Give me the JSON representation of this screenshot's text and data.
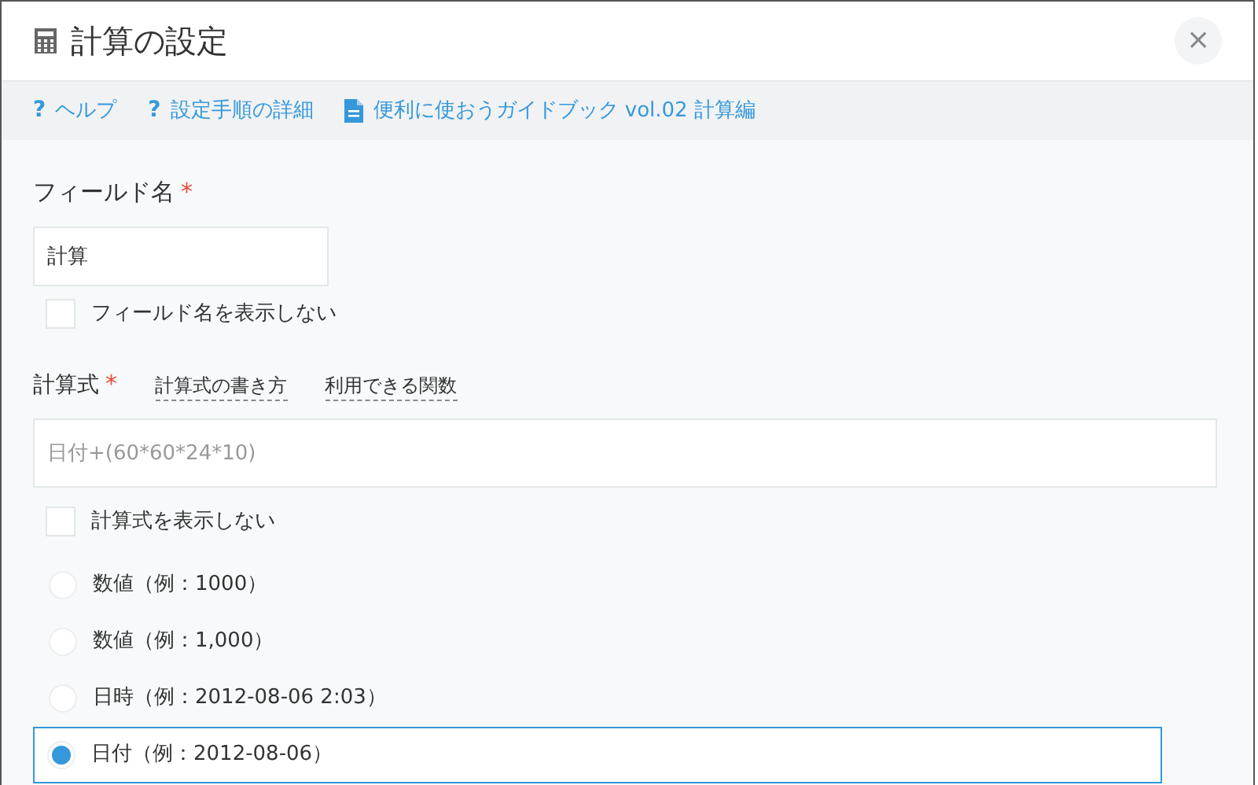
{
  "dialog": {
    "title": "計算の設定",
    "close": "×"
  },
  "links": [
    {
      "kind": "help",
      "icon": "?",
      "label": "ヘルプ"
    },
    {
      "kind": "help",
      "icon": "?",
      "label": "設定手順の詳細"
    },
    {
      "kind": "doc",
      "label": "便利に使おうガイドブック vol.02 計算編"
    }
  ],
  "field_name": {
    "label": "フィールド名",
    "required": "*",
    "value": "計算",
    "hide_label": {
      "label": "フィールド名を表示しない",
      "checked": false
    }
  },
  "formula": {
    "label": "計算式",
    "required": "*",
    "links": [
      "計算式の書き方",
      "利用できる関数"
    ],
    "placeholder": "日付+(60*60*24*10)",
    "hide_formula": {
      "label": "計算式を表示しない",
      "checked": false
    }
  },
  "formats": [
    {
      "label": "数値（例：1000）",
      "selected": false
    },
    {
      "label": "数値（例：1,000）",
      "selected": false
    },
    {
      "label": "日時（例：2012-08-06 2:03）",
      "selected": false
    },
    {
      "label": "日付（例：2012-08-06）",
      "selected": true
    }
  ]
}
